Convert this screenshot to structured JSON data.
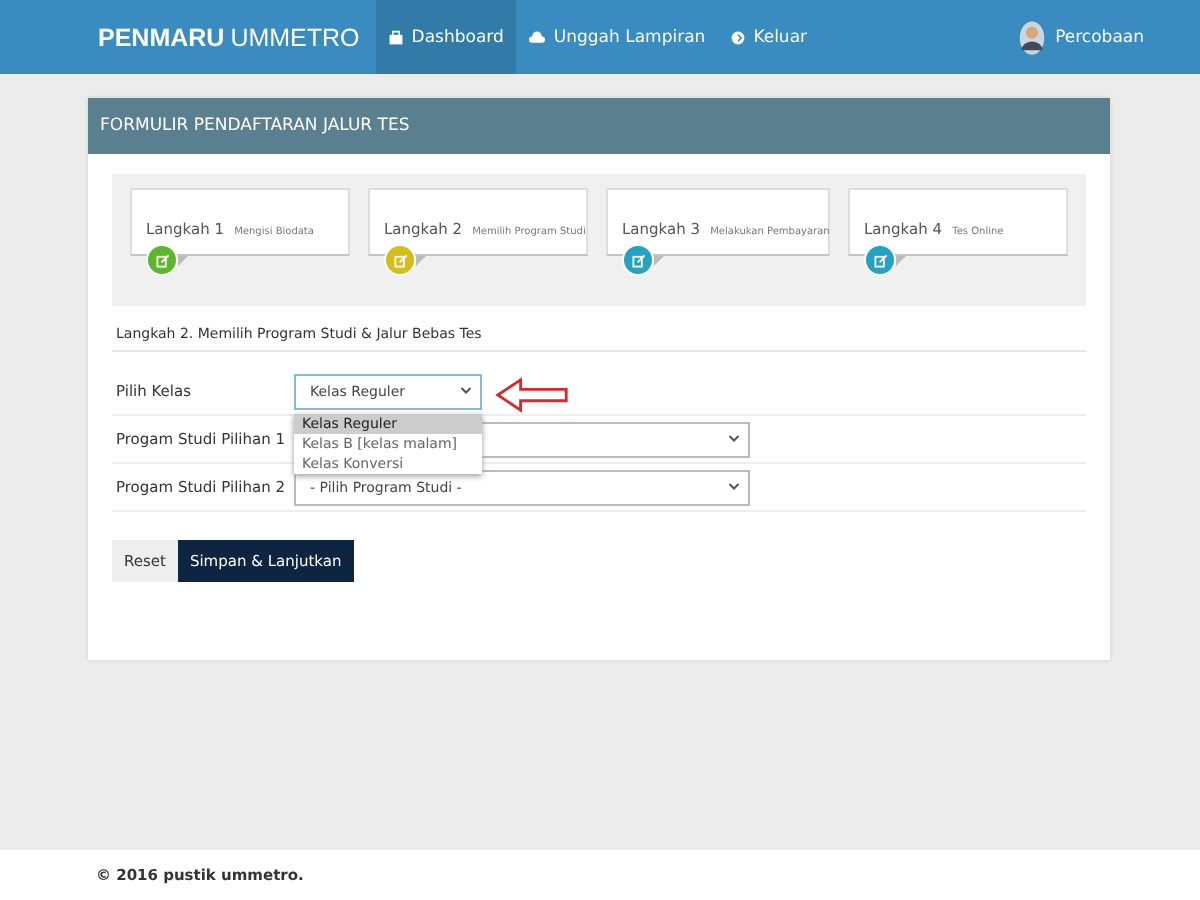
{
  "navbar": {
    "brand_bold": "PENMARU",
    "brand_light": "UMMETRO",
    "items": [
      {
        "label": "Dashboard",
        "kind": "dashboard",
        "selected": true
      },
      {
        "label": "Unggah Lampiran",
        "kind": "upload",
        "selected": false
      },
      {
        "label": "Keluar",
        "kind": "logout",
        "selected": false
      }
    ],
    "user": {
      "name": "Percobaan"
    }
  },
  "panel": {
    "title": "FORMULIR PENDAFTARAN JALUR TES",
    "steps": [
      {
        "step": "Langkah 1",
        "desc": "Mengisi Biodata",
        "color": "#5cb82a"
      },
      {
        "step": "Langkah 2",
        "desc": "Memilih Program Studi",
        "color": "#d4bf1a"
      },
      {
        "step": "Langkah 3",
        "desc": "Melakukan Pembayaran",
        "color": "#24a2c2"
      },
      {
        "step": "Langkah 4",
        "desc": "Tes Online",
        "color": "#24a2c2"
      }
    ],
    "section_title": "Langkah 2. Memilih Program Studi & Jalur Bebas Tes",
    "fields": [
      {
        "label": "Pilih Kelas",
        "value": "Kelas Reguler",
        "expanded": true,
        "options": [
          {
            "label": "Kelas Reguler",
            "selected": true
          },
          {
            "label": "Kelas B [kelas malam]",
            "selected": false
          },
          {
            "label": "Kelas Konversi",
            "selected": false
          }
        ]
      },
      {
        "label": "Progam Studi Pilihan 1",
        "expanded": false
      },
      {
        "label": "Progam Studi Pilihan 2",
        "value": "- Pilih Program Studi -",
        "expanded": false
      }
    ],
    "buttons": [
      {
        "label": "Reset",
        "kind": "default"
      },
      {
        "label": "Simpan & Lanjutkan",
        "kind": "primary"
      }
    ]
  },
  "footer": "© 2016 pustik ummetro."
}
